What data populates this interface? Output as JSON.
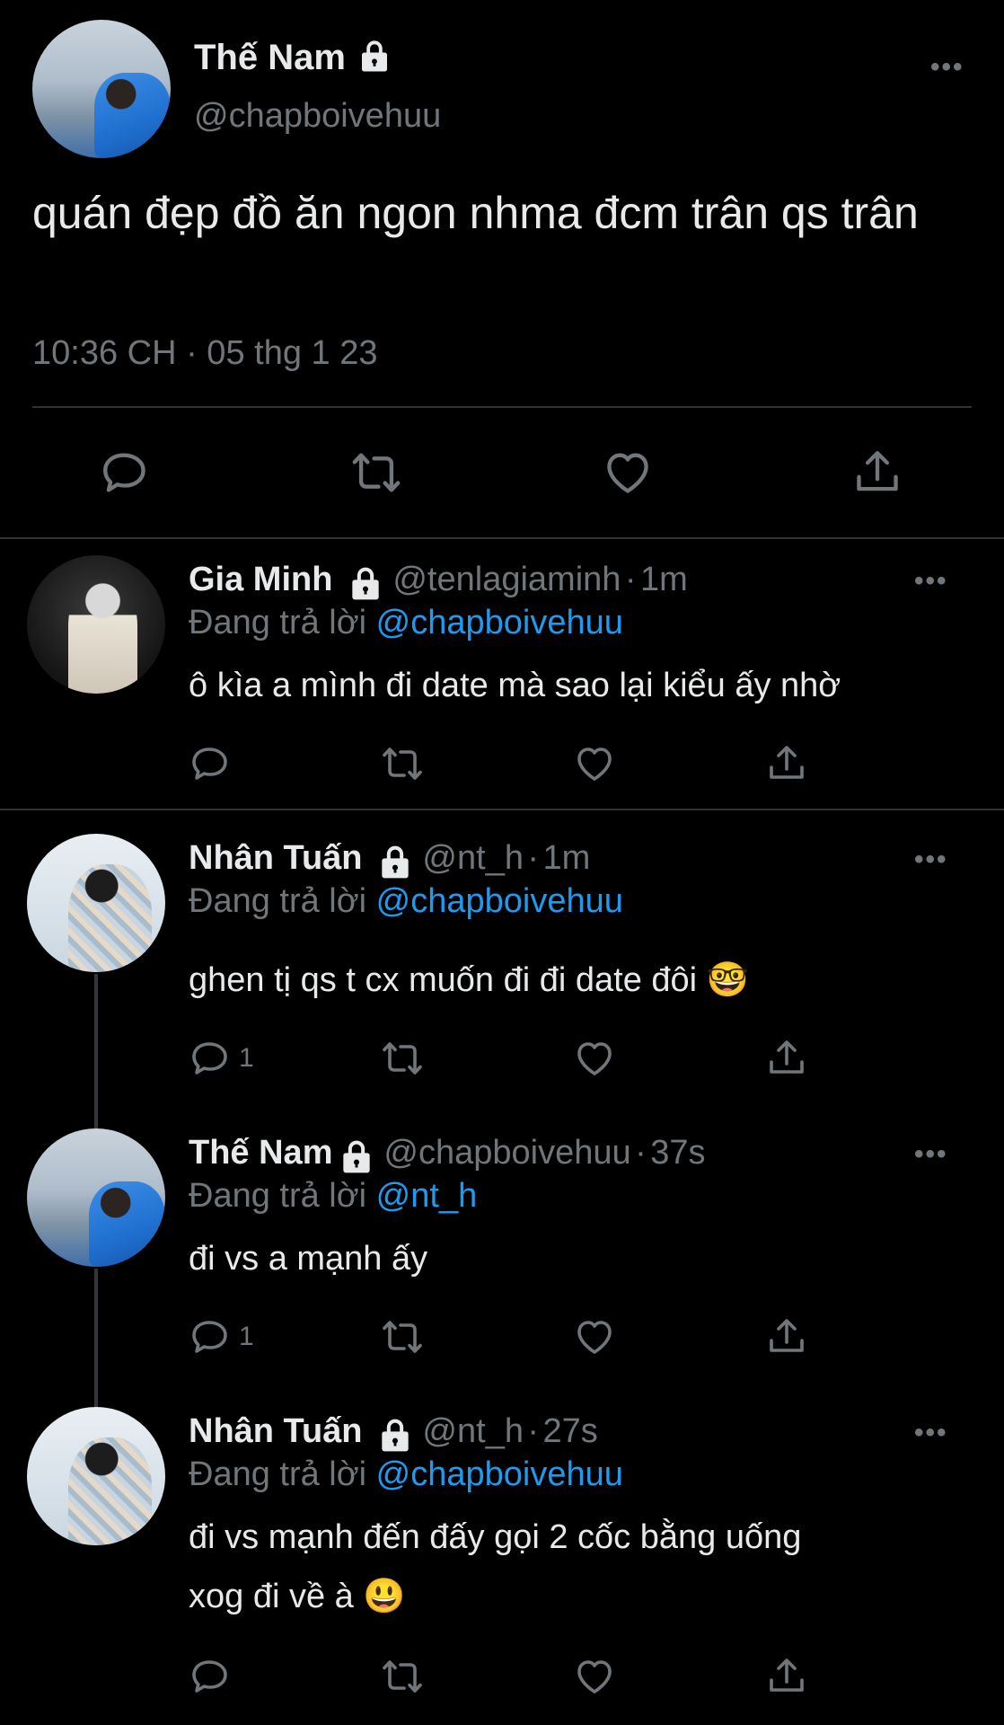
{
  "main_tweet": {
    "name": "Thế Nam",
    "handle": "@chapboivehuu",
    "text": "quán đẹp đồ ăn ngon nhma đcm trân qs trân",
    "timestamp": "10:36 CH · 05 thg 1 23"
  },
  "replies": [
    {
      "name": "Gia Minh",
      "handle": "@tenlagiaminh",
      "time": "1m",
      "replying_label": "Đang trả lời",
      "replying_to": "@chapboivehuu",
      "text": "ô kìa a mình đi date mà sao lại kiểu ấy nhờ",
      "reply_count": ""
    },
    {
      "name": "Nhân Tuấn",
      "handle": "@nt_h",
      "time": "1m",
      "replying_label": "Đang trả lời",
      "replying_to": "@chapboivehuu",
      "text": "ghen tị qs t cx muốn đi đi date đôi 🤓",
      "reply_count": "1"
    },
    {
      "name": "Thế Nam",
      "handle": "@chapboivehuu",
      "time": "37s",
      "replying_label": "Đang trả lời",
      "replying_to": "@nt_h",
      "text": "đi vs a mạnh ấy",
      "reply_count": "1"
    },
    {
      "name": "Nhân Tuấn",
      "handle": "@nt_h",
      "time": "27s",
      "replying_label": "Đang trả lời",
      "replying_to": "@chapboivehuu",
      "text_line1": "đi vs mạnh đến đấy gọi 2 cốc bằng uống",
      "text_line2": "xog đi về à 😃",
      "reply_count": ""
    }
  ],
  "separator": "·",
  "more_label": "•••",
  "icons": [
    "lock-icon",
    "reply-icon",
    "retweet-icon",
    "like-icon",
    "share-icon",
    "more-icon"
  ],
  "colors": {
    "background": "#000000",
    "text": "#e7e9ea",
    "muted": "#71767b",
    "link": "#1d9bf0",
    "divider": "#2f3336"
  }
}
